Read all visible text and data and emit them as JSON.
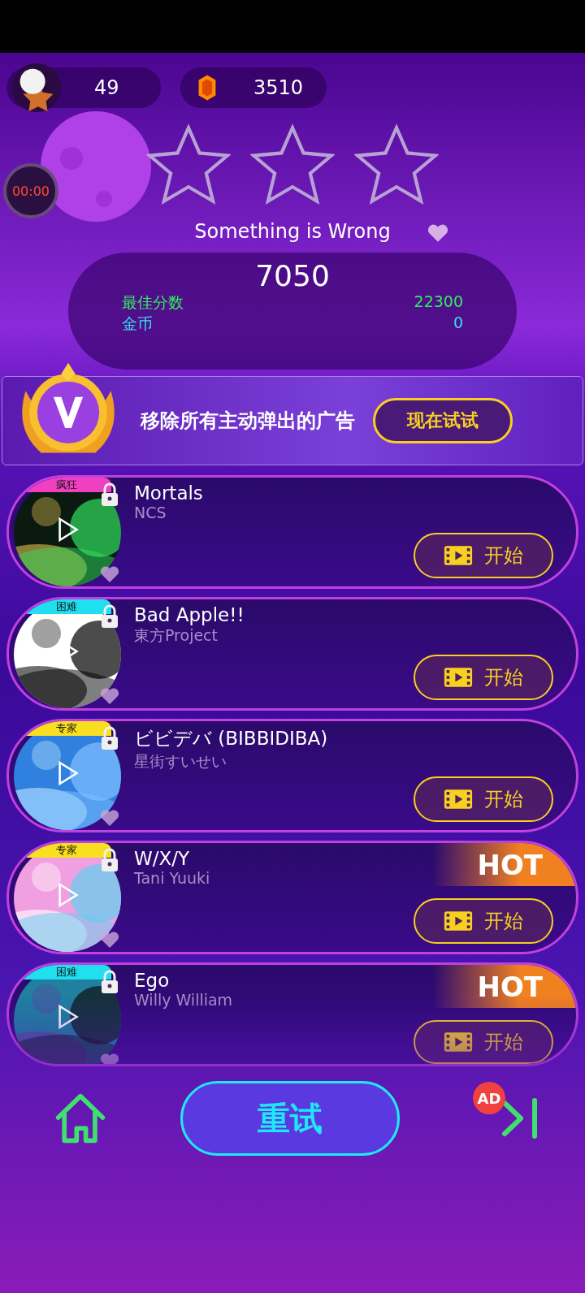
{
  "currency": {
    "star_count": "49",
    "gems": "3510"
  },
  "timer": "00:00",
  "result": {
    "stars": 0,
    "song_title": "Something is Wrong",
    "score": "7050",
    "best_label": "最佳分数",
    "best_value": "22300",
    "coins_label": "金币",
    "coins_value": "0"
  },
  "vip_banner": {
    "text": "移除所有主动弹出的广告",
    "button": "现在试试"
  },
  "songs": [
    {
      "title": "Mortals",
      "artist": "NCS",
      "difficulty": "疯狂",
      "color": "#f040c0",
      "hot": false,
      "locked": true,
      "button": "开始"
    },
    {
      "title": "Bad Apple!!",
      "artist": "東方Project",
      "difficulty": "困难",
      "color": "#20e0f0",
      "hot": false,
      "locked": true,
      "button": "开始"
    },
    {
      "title": "ビビデバ (BIBBIDIBA)",
      "artist": "星街すいせい",
      "difficulty": "专家",
      "color": "#f8e020",
      "hot": false,
      "locked": true,
      "button": "开始"
    },
    {
      "title": "W/X/Y",
      "artist": "Tani Yuuki",
      "difficulty": "专家",
      "color": "#f8e020",
      "hot": true,
      "hot_label": "HOT",
      "locked": true,
      "button": "开始"
    },
    {
      "title": "Ego",
      "artist": "Willy William",
      "difficulty": "困难",
      "color": "#20e0f0",
      "hot": true,
      "hot_label": "HOT",
      "locked": true,
      "button": "开始"
    }
  ],
  "bottom_bar": {
    "retry": "重试",
    "ad_badge": "AD"
  }
}
